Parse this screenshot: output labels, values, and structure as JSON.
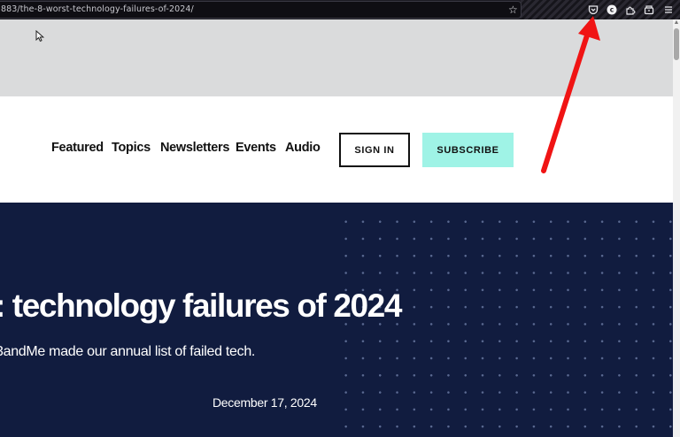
{
  "browser": {
    "url": "883/the-8-worst-technology-failures-of-2024/",
    "toolbar_icons": [
      "pocket-icon",
      "profile-icon",
      "extensions-icon",
      "containers-icon",
      "menu-icon"
    ],
    "profile_letter": "c"
  },
  "nav": {
    "links": [
      "Featured",
      "Topics",
      "Newsletters",
      "Events",
      "Audio"
    ],
    "signin_label": "SIGN IN",
    "subscribe_label": "SUBSCRIBE"
  },
  "hero": {
    "title": ": technology failures of 2024",
    "subtitle": "3andMe made our annual list of failed tech.",
    "date": "December 17, 2024"
  },
  "colors": {
    "hero_bg": "#111c3f",
    "subscribe_bg": "#9ff3e6",
    "ad_bg": "#dadbdc",
    "annotation_arrow": "#f01414"
  }
}
